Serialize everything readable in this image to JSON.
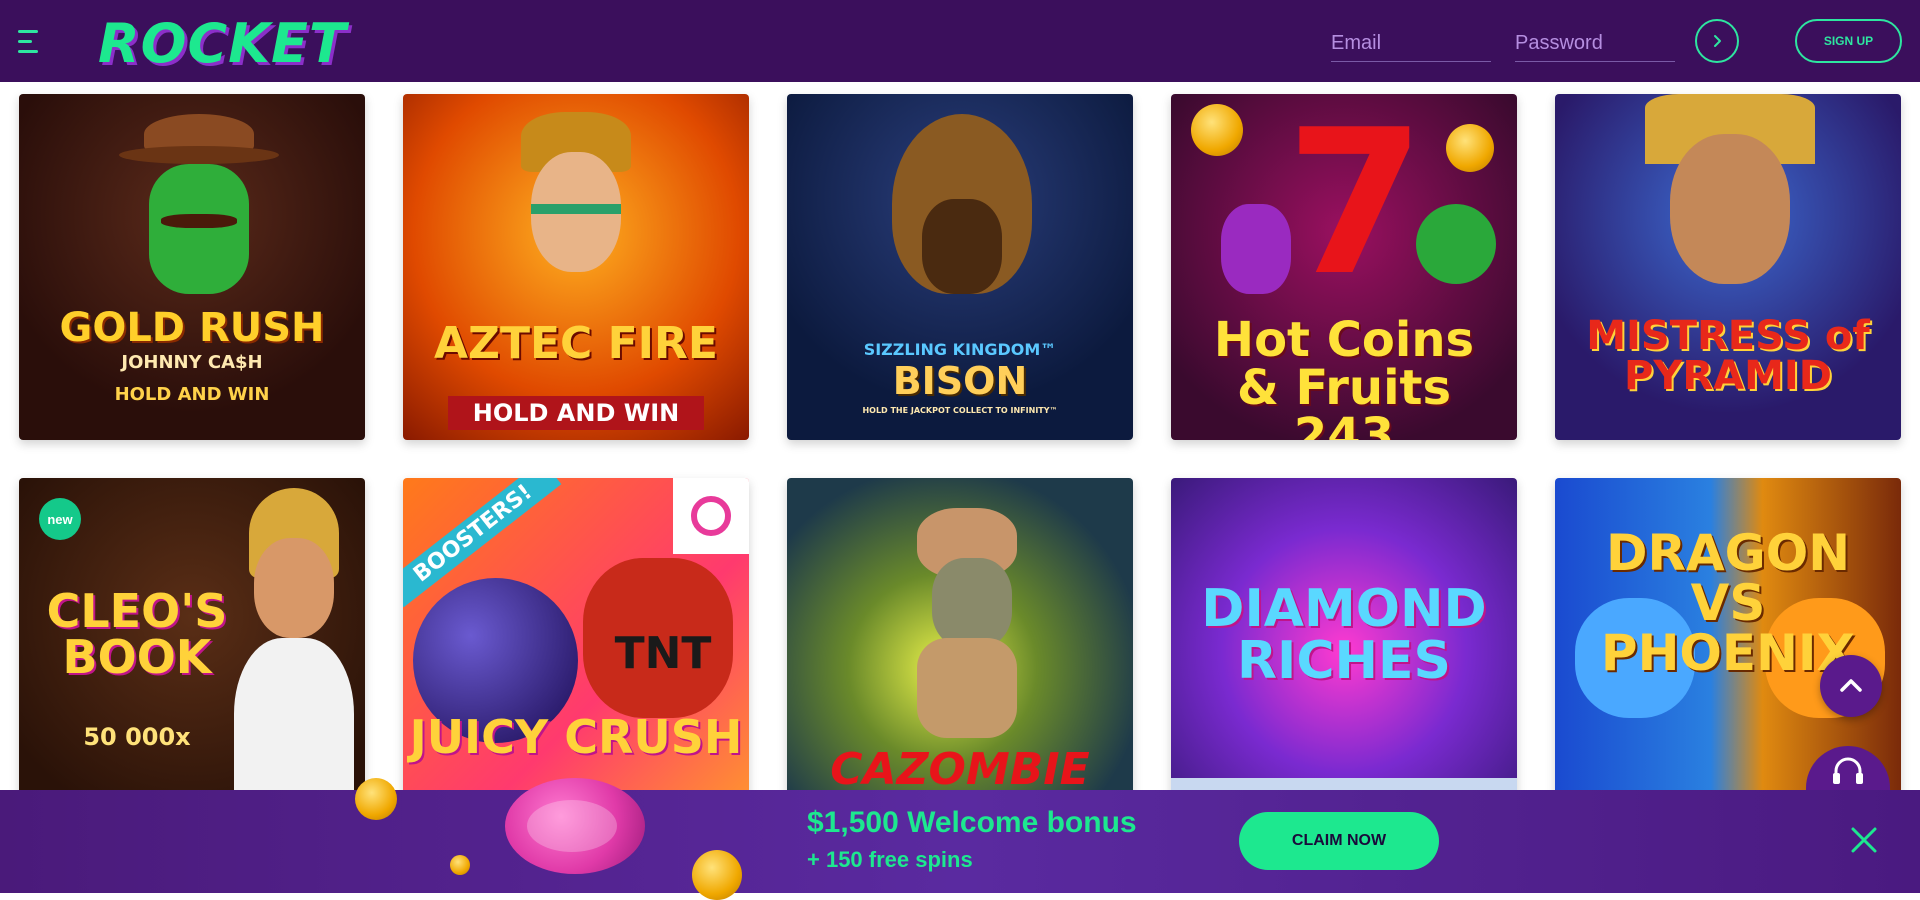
{
  "header": {
    "logo": "ROCKET",
    "email_placeholder": "Email",
    "password_placeholder": "Password",
    "signup_label": "SIGN UP"
  },
  "games": [
    {
      "title": "GOLD RUSH",
      "subtitle": "JOHNNY CA$H",
      "tagline": "HOLD AND WIN"
    },
    {
      "title": "AZTEC FIRE",
      "subtitle": "HOLD AND WIN"
    },
    {
      "title": "BISON",
      "subtitle": "SIZZLING KINGDOM™",
      "tagline": "HOLD THE JACKPOT COLLECT TO INFINITY™"
    },
    {
      "title": "Hot Coins & Fruits 243"
    },
    {
      "title": "MISTRESS of PYRAMID"
    },
    {
      "title": "CLEO'S BOOK",
      "subtitle": "50 000x",
      "badge": "new"
    },
    {
      "title": "JUICY CRUSH",
      "subtitle": "BOOSTERS!",
      "tagline": "TNT"
    },
    {
      "title": "CAZOMBIE"
    },
    {
      "title": "DIAMOND RICHES"
    },
    {
      "title": "DRAGON VS PHOENIX"
    }
  ],
  "bonus": {
    "title": "$1,500 Welcome bonus",
    "subtitle": "+ 150 free spins",
    "claim_label": "CLAIM NOW"
  },
  "colors": {
    "header_bg": "#3b0f5c",
    "accent": "#1de88f",
    "bonus_bg": "#5a2aa0"
  }
}
